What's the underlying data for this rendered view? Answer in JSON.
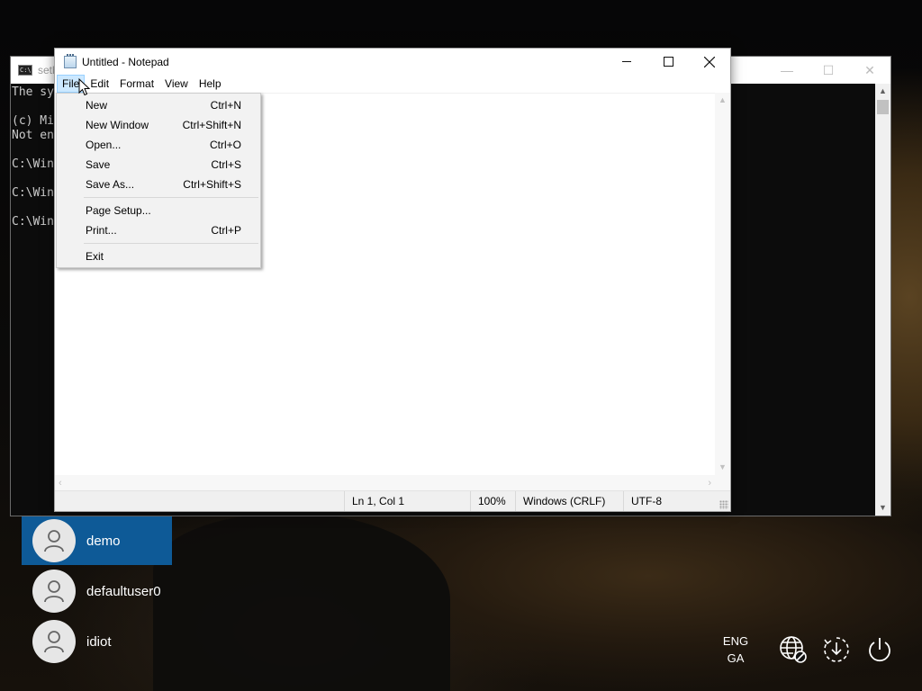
{
  "cmd_window": {
    "title": "seth",
    "icon_label": "C:\\",
    "console_lines": [
      "The sy",
      "",
      "(c) Mi",
      "Not en",
      "",
      "C:\\Win",
      "",
      "C:\\Win",
      "",
      "C:\\Win"
    ]
  },
  "notepad": {
    "title": "Untitled - Notepad",
    "menu": [
      "File",
      "Edit",
      "Format",
      "View",
      "Help"
    ],
    "active_menu": "File",
    "status": {
      "position": "Ln 1, Col 1",
      "zoom": "100%",
      "line_ending": "Windows (CRLF)",
      "encoding": "UTF-8"
    }
  },
  "file_menu": {
    "items": [
      {
        "label": "New",
        "shortcut": "Ctrl+N"
      },
      {
        "label": "New Window",
        "shortcut": "Ctrl+Shift+N"
      },
      {
        "label": "Open...",
        "shortcut": "Ctrl+O"
      },
      {
        "label": "Save",
        "shortcut": "Ctrl+S"
      },
      {
        "label": "Save As...",
        "shortcut": "Ctrl+Shift+S"
      },
      {
        "label": "Page Setup...",
        "shortcut": ""
      },
      {
        "label": "Print...",
        "shortcut": "Ctrl+P"
      },
      {
        "label": "Exit",
        "shortcut": ""
      }
    ]
  },
  "users": [
    {
      "name": "demo",
      "selected": true
    },
    {
      "name": "defaultuser0",
      "selected": false
    },
    {
      "name": "idiot",
      "selected": false
    }
  ],
  "tray": {
    "lang_line1": "ENG",
    "lang_line2": "GA",
    "icons": [
      "network-icon",
      "accessibility-icon",
      "power-icon"
    ]
  },
  "colors": {
    "selected_user_bg": "#0e5a97",
    "menu_active_bg": "#cce8ff"
  }
}
